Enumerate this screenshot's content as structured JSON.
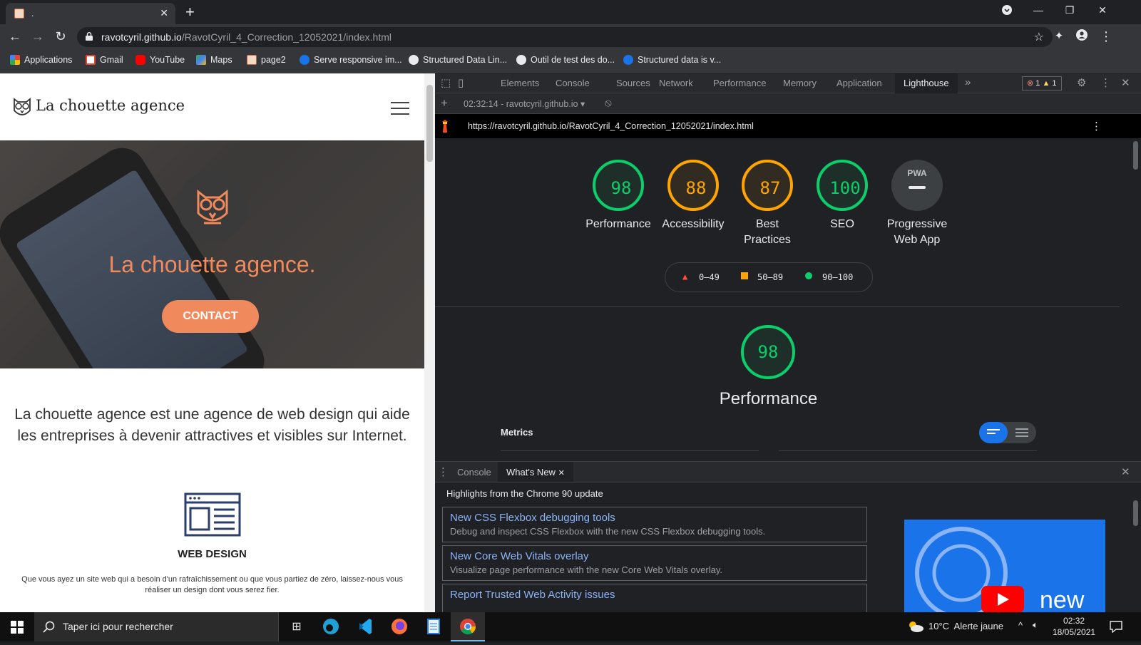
{
  "browser": {
    "tab_title": ".",
    "url_host": "ravotcyril.github.io",
    "url_path": "/RavotCyril_4_Correction_12052021/index.html",
    "bookmarks": [
      {
        "label": "Applications",
        "icon": "apps-grid-icon"
      },
      {
        "label": "Gmail",
        "icon": "gmail-icon"
      },
      {
        "label": "YouTube",
        "icon": "youtube-icon"
      },
      {
        "label": "Maps",
        "icon": "maps-icon"
      },
      {
        "label": "page2",
        "icon": "page-icon"
      },
      {
        "label": "Serve responsive im...",
        "icon": "web-dev-icon"
      },
      {
        "label": "Structured Data Lin...",
        "icon": "globe-icon"
      },
      {
        "label": "Outil de test des do...",
        "icon": "globe-icon"
      },
      {
        "label": "Structured data is v...",
        "icon": "web-dev-icon"
      }
    ]
  },
  "site": {
    "logo_text": "La chouette agence",
    "hero_title": "La chouette agence.",
    "contact_label": "CONTACT",
    "intro_line1": "La chouette agence est une agence de web design qui aide",
    "intro_line2": "les entreprises à devenir attractives et visibles sur Internet.",
    "service_title": "WEB DESIGN",
    "service_text_line1": "Que vous ayez un site web qui a besoin d'un rafraîchissement ou que vous partiez de zéro, laissez-nous vous",
    "service_text_line2": "réaliser un design dont vous serez fier."
  },
  "devtools": {
    "tabs": [
      "Elements",
      "Console",
      "Sources",
      "Network",
      "Performance",
      "Memory",
      "Application",
      "Lighthouse"
    ],
    "active_tab": "Lighthouse",
    "more_tabs": "»",
    "error_count": "1",
    "warning_count": "1",
    "report_selector": "02:32:14 - ravotcyril.github.io",
    "report_url": "https://ravotcyril.github.io/RavotCyril_4_Correction_12052021/index.html",
    "scores": [
      {
        "label": "Performance",
        "value": "98",
        "color": "#0cce6b"
      },
      {
        "label": "Accessibility",
        "value": "88",
        "color": "#ffa400"
      },
      {
        "label": "Best\nPractices",
        "value": "87",
        "color": "#ffa400"
      },
      {
        "label": "SEO",
        "value": "100",
        "color": "#0cce6b"
      },
      {
        "label": "Progressive\nWeb App",
        "value": "PWA",
        "color": "#9aa0a6"
      }
    ],
    "legend": {
      "fail": "0–49",
      "average": "50–89",
      "pass": "90–100"
    },
    "perf_score": "98",
    "perf_title": "Performance",
    "metrics_label": "Metrics",
    "drawer_tabs": [
      "Console",
      "What's New"
    ],
    "drawer_active": "What's New",
    "drawer_heading": "Highlights from the Chrome 90 update",
    "whats_new": [
      {
        "title": "New CSS Flexbox debugging tools",
        "desc": "Debug and inspect CSS Flexbox with the new CSS Flexbox debugging tools."
      },
      {
        "title": "New Core Web Vitals overlay",
        "desc": "Visualize page performance with the new Core Web Vitals overlay."
      },
      {
        "title": "Report Trusted Web Activity issues",
        "desc": ""
      }
    ],
    "video_caption": "new"
  },
  "taskbar": {
    "search_placeholder": "Taper ici pour rechercher",
    "weather": "10°C  Alerte jaune",
    "time": "02:32",
    "date": "18/05/2021"
  }
}
